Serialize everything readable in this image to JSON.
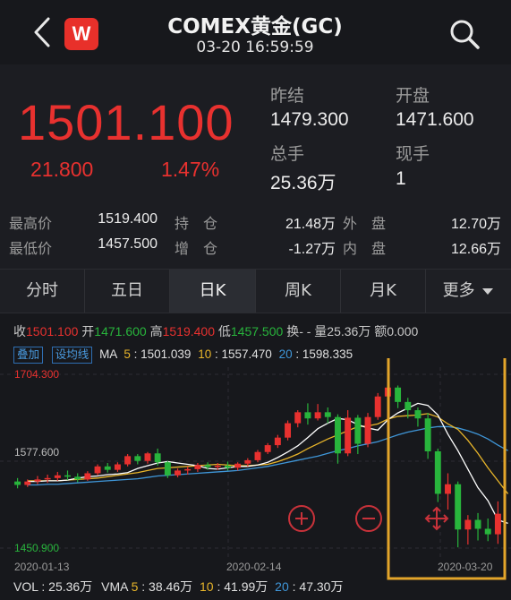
{
  "header": {
    "title": "COMEX黄金(GC)",
    "datetime": "03-20 16:59:59",
    "logo_text": "W"
  },
  "quote": {
    "last_price": "1501.100",
    "change": "21.800",
    "change_pct": "1.47%",
    "prev_close_label": "昨结",
    "prev_close": "1479.300",
    "open_label": "开盘",
    "open": "1471.600",
    "volume_label": "总手",
    "volume": "25.36万",
    "current_hand_label": "现手",
    "current_hand": "1",
    "high_label": "最高价",
    "high": "1519.400",
    "low_label": "最低价",
    "low": "1457.500",
    "open_interest_label": "持　仓",
    "open_interest": "21.48万",
    "oi_change_label": "增　仓",
    "oi_change": "-1.27万",
    "outer_label": "外　盘",
    "outer": "12.70万",
    "inner_label": "内　盘",
    "inner": "12.66万"
  },
  "tabs": [
    "分时",
    "五日",
    "日K",
    "周K",
    "月K",
    "更多"
  ],
  "active_tab": 2,
  "infobar": {
    "close_label": "收",
    "close": "1501.100",
    "open_label": "开",
    "open": "1471.600",
    "high_label": "高",
    "high": "1519.400",
    "low_label": "低",
    "low": "1457.500",
    "turnover_label": "换",
    "turnover": "- -",
    "volume_label": "量",
    "volume": "25.36万",
    "amount_label": "额",
    "amount": "0.000"
  },
  "ma_bar": {
    "overlay_btn": "叠加",
    "trendline_btn": "设均线",
    "ma_label": "MA",
    "ma5_label": "5",
    "ma5": "1501.039",
    "ma10_label": "10",
    "ma10": "1557.470",
    "ma20_label": "20",
    "ma20": "1598.335"
  },
  "chart_labels": {
    "y_top": "1704.300",
    "y_mid": "1577.600",
    "y_bottom": "1450.900",
    "x_start": "2020-01-13",
    "x_mid": "2020-02-14",
    "x_end": "2020-03-20"
  },
  "vol_bar": {
    "vol_label": "VOL",
    "vol": "25.36万",
    "vma_label": "VMA",
    "vma5_label": "5",
    "vma5": "38.46万",
    "vma10_label": "10",
    "vma10": "41.99万",
    "vma20_label": "20",
    "vma20": "47.30万"
  },
  "colors": {
    "up": "#e8312f",
    "down": "#28b43c",
    "ma5": "#ffffff",
    "ma10": "#e8b52a",
    "ma20": "#3f96d8",
    "highlight": "#e3a52a"
  },
  "chart_data": {
    "type": "candlestick",
    "ylim": [
      1450.9,
      1704.3
    ],
    "candles": [
      {
        "o": 1548,
        "h": 1553,
        "c": 1543,
        "l": 1538
      },
      {
        "o": 1543,
        "h": 1551,
        "c": 1548,
        "l": 1540
      },
      {
        "o": 1548,
        "h": 1556,
        "c": 1551,
        "l": 1544
      },
      {
        "o": 1551,
        "h": 1558,
        "c": 1553,
        "l": 1546
      },
      {
        "o": 1553,
        "h": 1562,
        "c": 1557,
        "l": 1549
      },
      {
        "o": 1557,
        "h": 1564,
        "c": 1555,
        "l": 1550
      },
      {
        "o": 1555,
        "h": 1560,
        "c": 1551,
        "l": 1547
      },
      {
        "o": 1551,
        "h": 1563,
        "c": 1560,
        "l": 1549
      },
      {
        "o": 1560,
        "h": 1573,
        "c": 1570,
        "l": 1557
      },
      {
        "o": 1570,
        "h": 1575,
        "c": 1565,
        "l": 1561
      },
      {
        "o": 1565,
        "h": 1576,
        "c": 1573,
        "l": 1562
      },
      {
        "o": 1573,
        "h": 1588,
        "c": 1585,
        "l": 1570
      },
      {
        "o": 1585,
        "h": 1588,
        "c": 1578,
        "l": 1573
      },
      {
        "o": 1578,
        "h": 1591,
        "c": 1589,
        "l": 1574
      },
      {
        "o": 1589,
        "h": 1596,
        "c": 1576,
        "l": 1571
      },
      {
        "o": 1576,
        "h": 1578,
        "c": 1557,
        "l": 1553
      },
      {
        "o": 1557,
        "h": 1567,
        "c": 1564,
        "l": 1554
      },
      {
        "o": 1564,
        "h": 1570,
        "c": 1566,
        "l": 1558
      },
      {
        "o": 1566,
        "h": 1575,
        "c": 1572,
        "l": 1562
      },
      {
        "o": 1572,
        "h": 1576,
        "c": 1569,
        "l": 1565
      },
      {
        "o": 1569,
        "h": 1575,
        "c": 1571,
        "l": 1565
      },
      {
        "o": 1571,
        "h": 1577,
        "c": 1568,
        "l": 1564
      },
      {
        "o": 1568,
        "h": 1576,
        "c": 1574,
        "l": 1564
      },
      {
        "o": 1574,
        "h": 1582,
        "c": 1579,
        "l": 1570
      },
      {
        "o": 1579,
        "h": 1594,
        "c": 1591,
        "l": 1576
      },
      {
        "o": 1591,
        "h": 1604,
        "c": 1601,
        "l": 1588
      },
      {
        "o": 1601,
        "h": 1616,
        "c": 1612,
        "l": 1597
      },
      {
        "o": 1612,
        "h": 1637,
        "c": 1633,
        "l": 1608
      },
      {
        "o": 1633,
        "h": 1652,
        "c": 1649,
        "l": 1627
      },
      {
        "o": 1649,
        "h": 1662,
        "c": 1640,
        "l": 1631
      },
      {
        "o": 1640,
        "h": 1661,
        "c": 1649,
        "l": 1637
      },
      {
        "o": 1649,
        "h": 1656,
        "c": 1642,
        "l": 1633
      },
      {
        "o": 1642,
        "h": 1646,
        "c": 1589,
        "l": 1574
      },
      {
        "o": 1589,
        "h": 1652,
        "c": 1641,
        "l": 1585
      },
      {
        "o": 1641,
        "h": 1645,
        "c": 1603,
        "l": 1588
      },
      {
        "o": 1603,
        "h": 1648,
        "c": 1642,
        "l": 1598
      },
      {
        "o": 1642,
        "h": 1677,
        "c": 1672,
        "l": 1638
      },
      {
        "o": 1672,
        "h": 1691,
        "c": 1685,
        "l": 1664
      },
      {
        "o": 1685,
        "h": 1688,
        "c": 1664,
        "l": 1655
      },
      {
        "o": 1664,
        "h": 1670,
        "c": 1652,
        "l": 1640
      },
      {
        "o": 1652,
        "h": 1656,
        "c": 1640,
        "l": 1628
      },
      {
        "o": 1640,
        "h": 1648,
        "c": 1592,
        "l": 1581
      },
      {
        "o": 1592,
        "h": 1596,
        "c": 1530,
        "l": 1518
      },
      {
        "o": 1530,
        "h": 1560,
        "c": 1544,
        "l": 1507
      },
      {
        "o": 1544,
        "h": 1548,
        "c": 1478,
        "l": 1452
      },
      {
        "o": 1478,
        "h": 1499,
        "c": 1492,
        "l": 1456
      },
      {
        "o": 1492,
        "h": 1502,
        "c": 1479,
        "l": 1462
      },
      {
        "o": 1479,
        "h": 1494,
        "c": 1471,
        "l": 1461
      },
      {
        "o": 1471,
        "h": 1519,
        "c": 1501,
        "l": 1457
      }
    ],
    "ma5": [
      1548,
      1548,
      1549,
      1549,
      1550,
      1553,
      1555,
      1556,
      1558,
      1559,
      1561,
      1567,
      1571,
      1575,
      1577,
      1575,
      1573,
      1571,
      1567,
      1566,
      1568,
      1570,
      1570,
      1572,
      1576,
      1583,
      1591,
      1600,
      1612,
      1625,
      1633,
      1640,
      1638,
      1631,
      1626,
      1623,
      1638,
      1648,
      1655,
      1662,
      1659,
      1645,
      1617,
      1593,
      1566,
      1539,
      1520,
      1492,
      1487
    ],
    "ma10": [
      1549,
      1549,
      1549,
      1549,
      1550,
      1551,
      1552,
      1553,
      1555,
      1557,
      1559,
      1561,
      1564,
      1567,
      1568,
      1569,
      1570,
      1571,
      1572,
      1573,
      1572,
      1571,
      1571,
      1572,
      1573,
      1577,
      1582,
      1588,
      1596,
      1603,
      1610,
      1616,
      1622,
      1628,
      1629,
      1632,
      1639,
      1643,
      1644,
      1645,
      1647,
      1642,
      1632,
      1624,
      1608,
      1589,
      1568,
      1549,
      1530
    ],
    "ma20": [
      1543,
      1543,
      1544,
      1544,
      1545,
      1546,
      1547,
      1548,
      1549,
      1550,
      1551,
      1552,
      1554,
      1556,
      1557,
      1558,
      1559,
      1560,
      1561,
      1562,
      1563,
      1564,
      1566,
      1568,
      1570,
      1573,
      1576,
      1579,
      1582,
      1585,
      1589,
      1593,
      1596,
      1600,
      1603,
      1606,
      1611,
      1616,
      1620,
      1623,
      1626,
      1628,
      1628,
      1626,
      1622,
      1617,
      1610,
      1601,
      1593
    ]
  }
}
